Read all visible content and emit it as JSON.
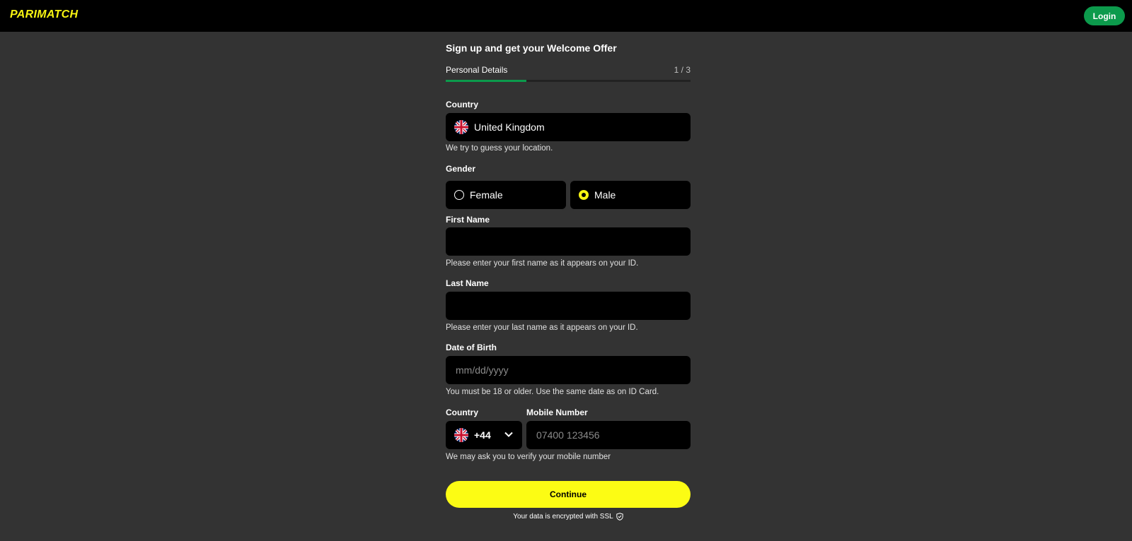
{
  "header": {
    "logo": "PARIMATCH",
    "login_label": "Login"
  },
  "form": {
    "title": "Sign up and get your Welcome Offer",
    "step_label": "Personal Details",
    "step_count": "1 / 3",
    "progress_fraction": 0.33,
    "country": {
      "label": "Country",
      "value": "United Kingdom",
      "flag_icon": "uk-flag-icon",
      "hint": "We try to guess your location."
    },
    "gender": {
      "label": "Gender",
      "options": [
        {
          "label": "Female",
          "selected": false
        },
        {
          "label": "Male",
          "selected": true
        }
      ]
    },
    "first_name": {
      "label": "First Name",
      "value": "",
      "hint": "Please enter your first name as it appears on your ID."
    },
    "last_name": {
      "label": "Last Name",
      "value": "",
      "hint": "Please enter your last name as it appears on your ID."
    },
    "dob": {
      "label": "Date of Birth",
      "placeholder": "mm/dd/yyyy",
      "hint": "You must be 18 or older. Use the same date as on ID Card."
    },
    "phone": {
      "country_label": "Country",
      "code": "+44",
      "number_label": "Mobile Number",
      "placeholder": "07400 123456",
      "hint": "We may ask you to verify your mobile number"
    },
    "continue_label": "Continue",
    "ssl_text": "Your data is encrypted with SSL"
  },
  "colors": {
    "accent_yellow": "#fcfc14",
    "accent_green": "#0c9a4c",
    "background": "#333333"
  }
}
